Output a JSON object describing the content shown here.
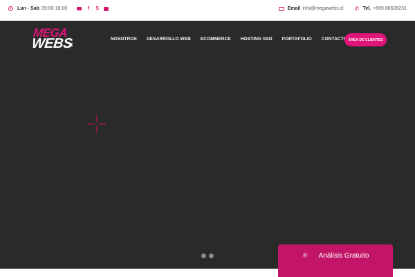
{
  "topbar": {
    "hours_label": "Lun - Sab",
    "hours_time": "09:00-18:00",
    "social_icons": [
      "mail-icon",
      "facebook-icon",
      "skype-icon",
      "youtube-icon"
    ],
    "email_label": "Email",
    "email_value": "info@megawebs.cl",
    "phone_label": "Tel.",
    "phone_value": "+569 86528231"
  },
  "brand": {
    "line1": "MEGA",
    "line2": "WEBS",
    "accent_color": "#e0157a"
  },
  "nav": {
    "items": [
      "NOSOTROS",
      "DESARROLLO WEB",
      "ECOMMERCE",
      "HOSTING SSD",
      "PORTAFOLIO",
      "CONTACTO"
    ],
    "client_button": "ÁREA DE CLIENTES"
  },
  "hero": {
    "background": "#2a2a2a",
    "slider_dots": 2
  },
  "widget": {
    "icon": "atom-icon",
    "label": "Análisis Gratuito"
  }
}
